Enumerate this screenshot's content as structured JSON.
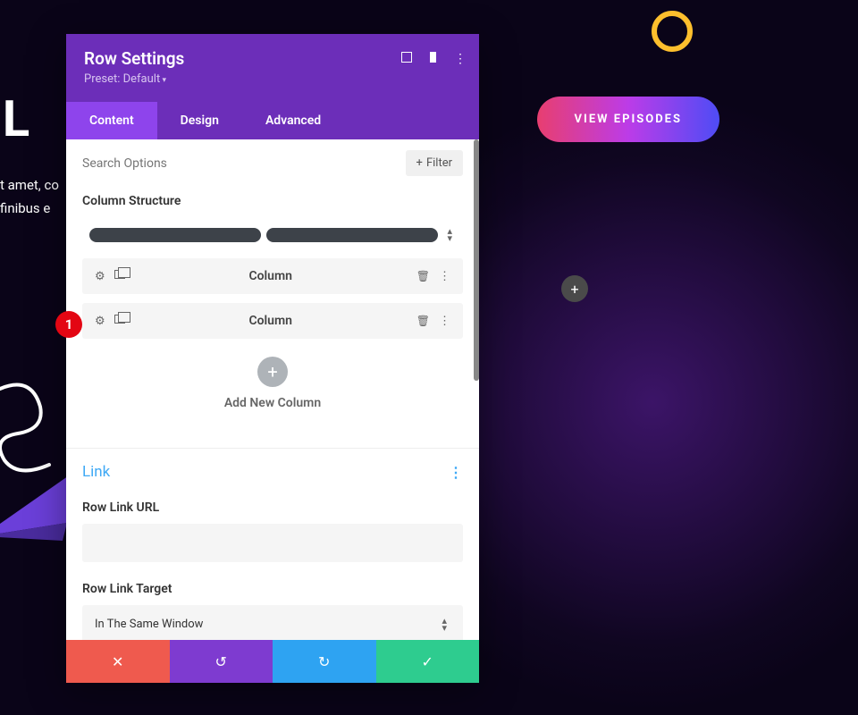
{
  "background": {
    "heading_fragment": "t L",
    "paragraph_line1": "t amet, co",
    "paragraph_line2": "finibus e",
    "cta_button": "VIEW EPISODES",
    "add_label": "+"
  },
  "panel": {
    "title": "Row Settings",
    "preset": "Preset: Default",
    "tabs": {
      "content": "Content",
      "design": "Design",
      "advanced": "Advanced"
    },
    "search_placeholder": "Search Options",
    "filter_label": "Filter",
    "filter_plus": "+",
    "column_structure_label": "Column Structure",
    "columns": [
      {
        "label": "Column"
      },
      {
        "label": "Column"
      }
    ],
    "add_column_label": "Add New Column",
    "add_plus": "+",
    "link": {
      "section_title": "Link",
      "url_label": "Row Link URL",
      "url_value": "",
      "target_label": "Row Link Target",
      "target_value": "In The Same Window"
    }
  },
  "badge_number": "1",
  "footer_icons": {
    "close": "✕",
    "undo": "↺",
    "redo": "↻",
    "save": "✓"
  }
}
